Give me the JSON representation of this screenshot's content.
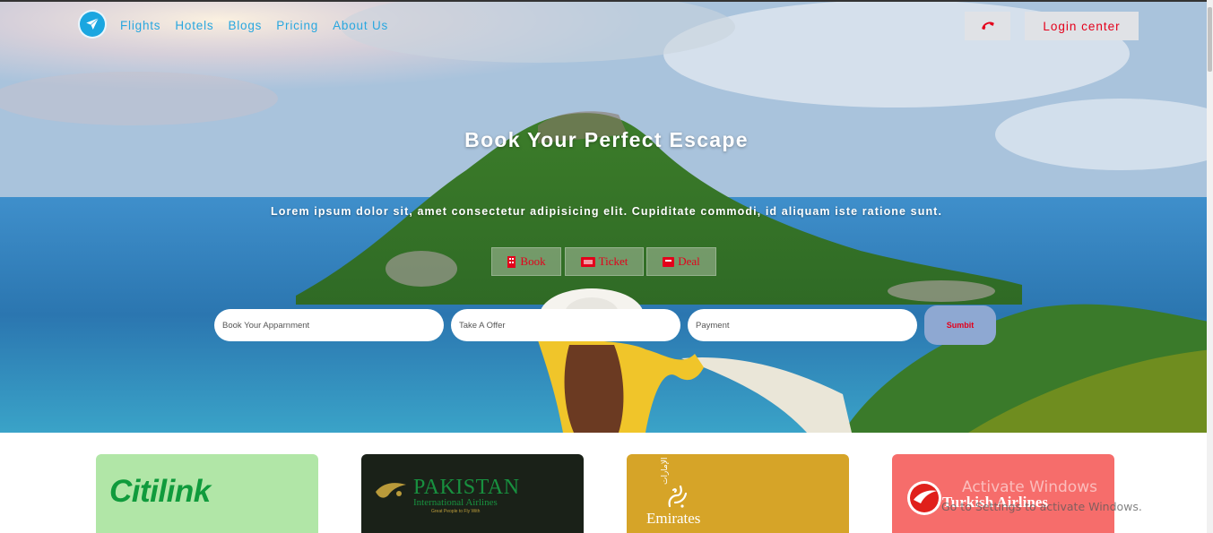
{
  "nav": {
    "items": [
      "Flights",
      "Hotels",
      "Blogs",
      "Pricing",
      "About Us"
    ],
    "logo_icon": "airplane-icon",
    "phone_icon": "phone-icon",
    "login_label": "Login center"
  },
  "hero": {
    "title": "Book Your Perfect Escape",
    "subtitle": "Lorem ipsum dolor sit, amet consectetur adipisicing elit. Cupiditate commodi, id aliquam iste ratione sunt.",
    "pills": [
      {
        "label": "Book",
        "icon": "building-icon"
      },
      {
        "label": "Ticket",
        "icon": "ticket-icon"
      },
      {
        "label": "Deal",
        "icon": "deal-icon"
      }
    ]
  },
  "form": {
    "field1_placeholder": "Book Your Apparnment",
    "field2_placeholder": "Take A Offer",
    "field3_placeholder": "Payment",
    "submit_label": "Sumbit"
  },
  "airlines": {
    "citilink": "Citilink",
    "pakistan_name": "PAKISTAN",
    "pakistan_sub": "International Airlines",
    "pakistan_tag": "Great People to Fly With",
    "emirates": "Emirates",
    "emirates_arabic": "طيران الإمارات",
    "turkish": "Turkish Airlines"
  },
  "watermark": {
    "title": "Activate Windows",
    "subtitle": "Go to Settings to activate Windows."
  },
  "colors": {
    "accent_red": "#e4001b",
    "nav_blue": "#29a7df",
    "submit_bg": "#8ea8d2"
  }
}
